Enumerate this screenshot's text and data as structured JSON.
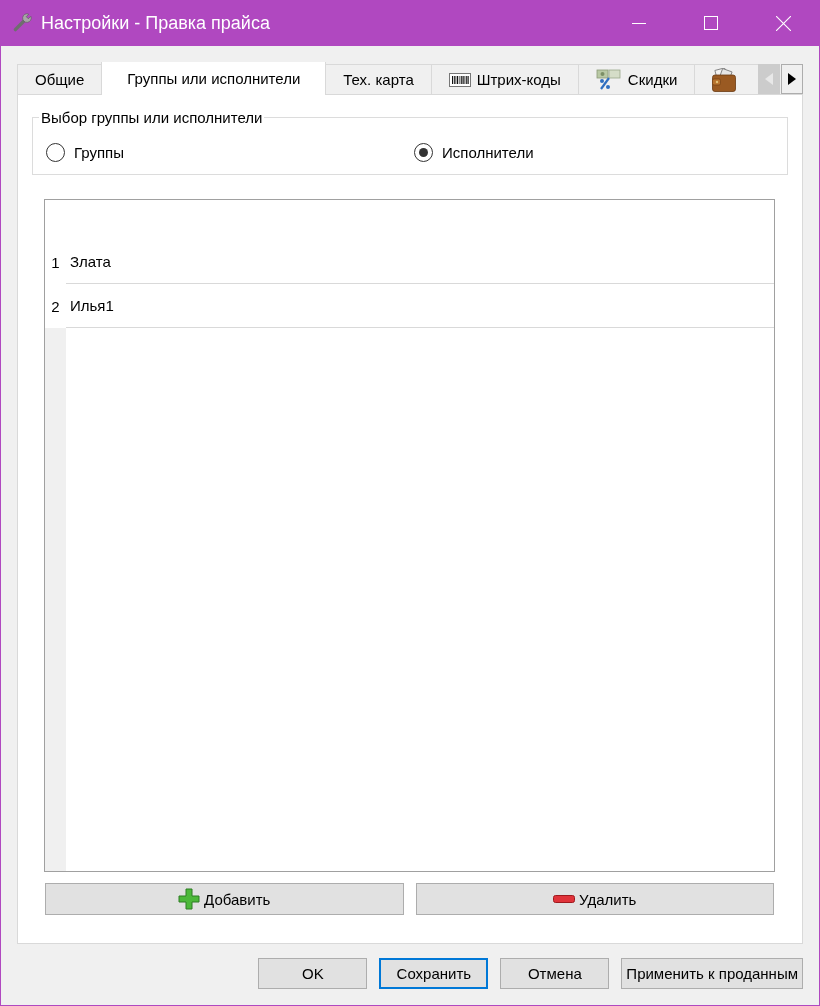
{
  "window": {
    "title": "Настройки - Правка прайса"
  },
  "tabs": [
    {
      "label": "Общие",
      "kind": "plain",
      "selected": false
    },
    {
      "label": "Группы или исполнители",
      "kind": "plain",
      "selected": true
    },
    {
      "label": "Тех. карта",
      "kind": "plain",
      "selected": false
    },
    {
      "label": "Штрих-коды",
      "kind": "barcode",
      "selected": false
    },
    {
      "label": "Скидки",
      "kind": "discount",
      "selected": false
    },
    {
      "kind": "wallet",
      "selected": false
    }
  ],
  "tab_scroll": [
    {
      "kind": "left",
      "disabled": true
    },
    {
      "kind": "right",
      "disabled": false
    }
  ],
  "group_box": {
    "title": "Выбор группы или исполнители",
    "options": [
      {
        "label": "Группы",
        "selected": false
      },
      {
        "label": "Исполнители",
        "selected": true
      }
    ]
  },
  "table": {
    "rows": [
      {
        "number": "1",
        "name": "Злата"
      },
      {
        "number": "2",
        "name": "Илья1"
      }
    ]
  },
  "list_buttons": [
    {
      "label": "Добавить",
      "kind": "add"
    },
    {
      "label": "Удалить",
      "kind": "remove"
    }
  ],
  "dialog_buttons": [
    {
      "label": "OK",
      "focused": false
    },
    {
      "label": "Сохранить",
      "focused": true
    },
    {
      "label": "Отмена",
      "focused": false
    },
    {
      "label": "Применить к проданным",
      "focused": false
    }
  ]
}
